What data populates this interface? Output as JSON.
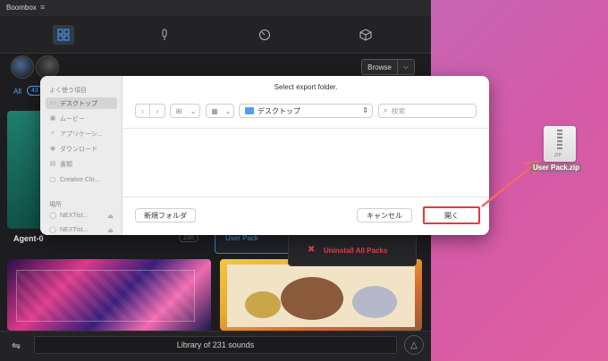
{
  "app": {
    "title": "Boombox",
    "menu_glyph": "≡",
    "nav_icons": [
      "grid-icon",
      "mic-icon",
      "dial-icon",
      "cube-icon"
    ],
    "browse_label": "Browse",
    "browse_chevron": "⌵",
    "tab_all": "All",
    "tab_count": "43",
    "agent_card_label": "Agent-0",
    "agent_card_count": "230",
    "user_pack_label": "User Pack",
    "uninstall_label": "Uninstall All Packs",
    "library_label": "Library of 231 sounds",
    "footer_settings_glyph": "⇋",
    "footer_warn_glyph": "△"
  },
  "dialog": {
    "title": "Select export folder.",
    "sidebar": {
      "favorites_heading": "よく使う項目",
      "favorites": [
        {
          "label": "デスクトップ",
          "icon": "desktop-icon",
          "selected": true
        },
        {
          "label": "ムービー",
          "icon": "movie-icon"
        },
        {
          "label": "アプリケーシ...",
          "icon": "apps-icon"
        },
        {
          "label": "ダウンロード",
          "icon": "download-icon"
        },
        {
          "label": "書類",
          "icon": "document-icon"
        },
        {
          "label": "Creative Clo...",
          "icon": "cloud-icon"
        }
      ],
      "locations_heading": "場所",
      "locations": [
        {
          "label": "NEXTist...",
          "icon": "disk-icon"
        },
        {
          "label": "NEXTist...",
          "icon": "disk-icon"
        }
      ]
    },
    "toolbar": {
      "back": "‹",
      "forward": "›",
      "view_icon": "⊞",
      "group_icon": "▦",
      "chevron": "⌄",
      "folder": "デスクトップ",
      "folder_updown": "⇕",
      "search_placeholder": "検索"
    },
    "new_folder_label": "新規フォルダ",
    "cancel_label": "キャンセル",
    "open_label": "開く"
  },
  "desktop": {
    "file_name": "User Pack.zip",
    "file_badge": "ZIP"
  },
  "colors": {
    "highlight": "#e53a3a",
    "accent_blue": "#4da3ff",
    "uninstall_red": "#e6424e"
  }
}
